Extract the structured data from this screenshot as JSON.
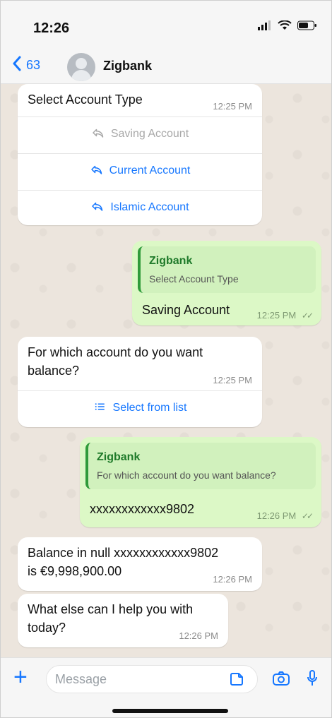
{
  "status_bar": {
    "time": "12:26"
  },
  "header": {
    "back_count": "63",
    "contact_name": "Zigbank"
  },
  "messages": [
    {
      "text": "Select Account Type",
      "time": "12:25 PM",
      "actions": [
        {
          "label": "Saving Account",
          "state": "disabled",
          "icon": "reply-icon"
        },
        {
          "label": "Current Account",
          "state": "enabled",
          "icon": "reply-icon"
        },
        {
          "label": "Islamic Account",
          "state": "enabled",
          "icon": "reply-icon"
        }
      ]
    },
    {
      "quote_sender": "Zigbank",
      "quote_text": "Select Account Type",
      "text": "Saving Account",
      "time": "12:25 PM"
    },
    {
      "text_line1": "For which account do you want",
      "text_line2": "balance?",
      "time": "12:25 PM",
      "action": {
        "label": "Select from list",
        "icon": "list-icon"
      }
    },
    {
      "quote_sender": "Zigbank",
      "quote_text": "For which account do you want balance?",
      "text": "xxxxxxxxxxxx9802",
      "time": "12:26 PM"
    },
    {
      "text_line1": "Balance in null xxxxxxxxxxxx9802",
      "text_line2": "is €9,998,900.00",
      "time": "12:26 PM"
    },
    {
      "text_line1": "What else can I help you with",
      "text_line2": "today?",
      "time": "12:26 PM"
    }
  ],
  "input": {
    "placeholder": "Message"
  },
  "colors": {
    "accent": "#1677ff",
    "outgoing": "#dcf8c6",
    "quote_bar": "#2f9b3a",
    "quote_name": "#1f7a2a"
  }
}
